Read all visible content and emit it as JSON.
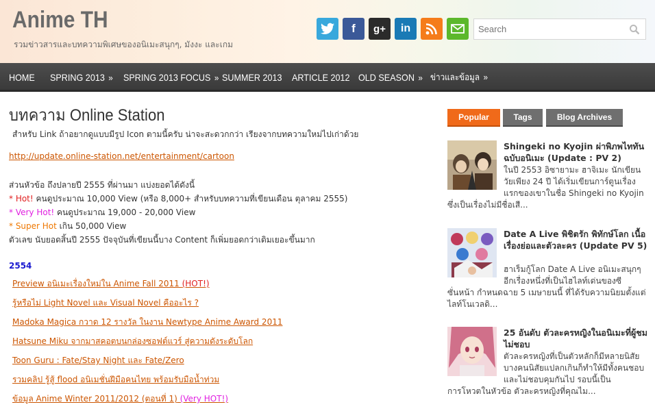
{
  "header": {
    "title": "Anime TH",
    "description": "รวมข่าวสารและบทความพิเศษของอนิเมะสนุกๆ, มังงะ และเกม",
    "social_icons": [
      {
        "icon": "twitter-icon",
        "glyph": "t",
        "color": "#38a8dc"
      },
      {
        "icon": "facebook-icon",
        "glyph": "f",
        "color": "#3b5998"
      },
      {
        "icon": "googleplus-icon",
        "glyph": "g+",
        "color": "#2b2b2b"
      },
      {
        "icon": "linkedin-icon",
        "glyph": "in",
        "color": "#1a7ab5"
      },
      {
        "icon": "rss-icon",
        "glyph": "))",
        "color": "#f57c1a"
      },
      {
        "icon": "email-icon",
        "glyph": "✉",
        "color": "#5cb82c"
      }
    ],
    "search_placeholder": "Search"
  },
  "nav": {
    "items": [
      {
        "label": "HOME",
        "has_submenu": false
      },
      {
        "label": "SPRING 2013",
        "has_submenu": true
      },
      {
        "label": "SPRING 2013 FOCUS",
        "has_submenu": true
      },
      {
        "label": "SUMMER 2013",
        "has_submenu": false
      },
      {
        "label": "ARTICLE 2012",
        "has_submenu": false
      },
      {
        "label": "OLD SEASON",
        "has_submenu": true
      },
      {
        "label": "ข่าวและข้อมูล",
        "has_submenu": true
      }
    ],
    "arrow": "»"
  },
  "main": {
    "title": "บทความ Online Station",
    "intro": "สำหรับ Link ถ้าอยากดูแบบมีรูป Icon ตามนี้ครับ น่าจะสะดวกกว่า เรียงจากบทความใหม่ไปเก่าด้วย",
    "link": "http://update.online-station.net/entertainment/cartoon",
    "summary": "ส่วนหัวข้อ ถึงปลายปี  2555 ที่ผ่านมา แบ่งยอดได้ดังนี้",
    "tiers": [
      {
        "tag": "* Hot!",
        "text": " คนดูประมาณ 10,000 View (หรือ 8,000+ สำหรับบทความที่เขียนเดือน ตุลาคม 2555)"
      },
      {
        "tag": "* Very Hot!",
        "text": " คนดูประมาณ 19,000 - 20,000 View"
      },
      {
        "tag": "* Super Hot",
        "text": " เกิน 50,000 View"
      }
    ],
    "footnote": "ตัวเลข นับยอดสิ้นปี 2555 ปัจจุบันที่เขียนนี้บาง Content ก็เพิ่มยอดกว่าเดิมเยอะขึ้นมาก",
    "year": "2554",
    "articles": [
      {
        "title": "Preview อนิเมะเรื่องใหม่ใน Anime Fall 2011 ",
        "note": "(HOT!)",
        "note_color": "#e02020"
      },
      {
        "title": "รู้หรือไม่ Light Novel และ Visual Novel คืออะไร ?",
        "note": "",
        "note_color": ""
      },
      {
        "title": "Madoka Magica กวาด 12 รางวัล ในงาน Newtype Anime Award 2011",
        "note": "",
        "note_color": ""
      },
      {
        "title": "Hatsune Miku จากมาสคอตบนกล่องซอฟต์แวร์ สู่ความดังระดับโลก",
        "note": "",
        "note_color": ""
      },
      {
        "title": "Toon Guru : Fate/Stay Night และ Fate/Zero",
        "note": "",
        "note_color": ""
      },
      {
        "title": "รวมคลิป รู้สู้ flood อนิเมชั่นฝีมือคนไทย พร้อมรับมือน้ำท่วม",
        "note": "",
        "note_color": ""
      },
      {
        "title": "ข้อมูล Anime Winter 2011/2012 (ตอนที่ 1)",
        "note": " (Very HOT!)",
        "note_color": "#e020e0"
      }
    ]
  },
  "sidebar": {
    "tabs": [
      "Popular",
      "Tags",
      "Blog Archives"
    ],
    "active_tab": "Popular",
    "posts": [
      {
        "title": "Shingeki no Kyojin ผ่าพิภพไททัน ฉบับอนิเมะ (Update : PV 2)",
        "excerpt_side": "ในปี 2553 อิซายามะ ฮาจิเมะ นักเขียนวัยเพียง 24 ปี ได้เริ่มเขียนการ์ตูนเรื่องแรกของเขาในชื่อ Shingeki no Kyojin",
        "excerpt_full": "ซึ่งเป็นเรื่องไม่มีชื่อเสี..."
      },
      {
        "title": "Date A Live พิชิตรัก พิทักษ์โลก เนื้อเรื่องย่อและตัวละคร (Update PV 5)",
        "excerpt_side": "ฮาเร็มกู้โลก Date A Live อนิเมะสนุกๆ อีกเรื่องหนึ่งที่เป็นไฮไลท์เด่นของซี",
        "excerpt_full": "ซั่นหน้า กำหนดฉาย 5 เมษายนนี้  ที่ได้รับความนิยมตั้งแต่ไลท์โนเวลดิ..."
      },
      {
        "title": "25 อันดับ ตัวละครหญิงในอนิเมะที่ผู้ชมไม่ชอบ",
        "excerpt_side": "ตัวละครหญิงที่เป็นตัวหลักก็มีหลายนิสัย บางคนนิสัยแปลกเกินก็ทำให้มีทั้งคนชอบและไม่ชอบคุมกันไป รอบนี้เป็น",
        "excerpt_full": "การโหวตในหัวข้อ ตัวละครหญิงที่คุณไม..."
      }
    ]
  }
}
